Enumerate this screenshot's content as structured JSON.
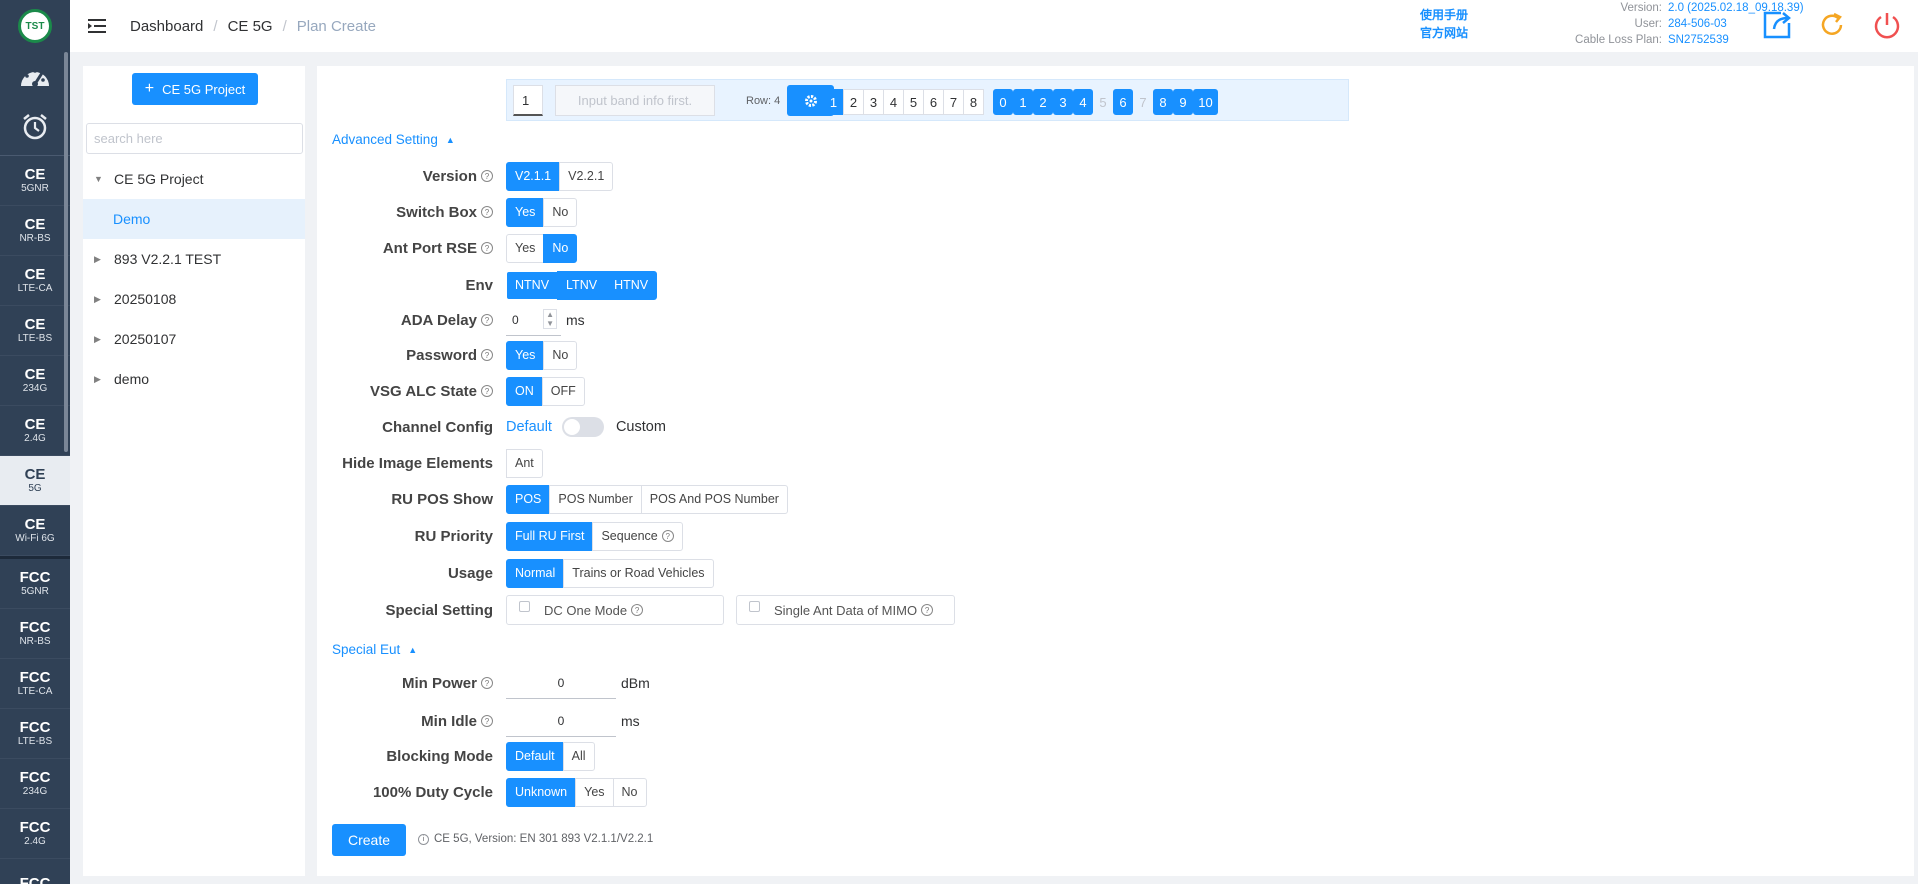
{
  "brand": {
    "logo_text": "TST"
  },
  "leftnav": {
    "items": [
      {
        "main": "CE",
        "sub": "5GNR"
      },
      {
        "main": "CE",
        "sub": "NR-BS"
      },
      {
        "main": "CE",
        "sub": "LTE-CA"
      },
      {
        "main": "CE",
        "sub": "LTE-BS"
      },
      {
        "main": "CE",
        "sub": "234G"
      },
      {
        "main": "CE",
        "sub": "2.4G"
      },
      {
        "main": "CE",
        "sub": "5G"
      },
      {
        "main": "CE",
        "sub": "Wi-Fi 6G"
      },
      {
        "main": "FCC",
        "sub": "5GNR"
      },
      {
        "main": "FCC",
        "sub": "NR-BS"
      },
      {
        "main": "FCC",
        "sub": "LTE-CA"
      },
      {
        "main": "FCC",
        "sub": "LTE-BS"
      },
      {
        "main": "FCC",
        "sub": "234G"
      },
      {
        "main": "FCC",
        "sub": "2.4G"
      },
      {
        "main": "FCC",
        "sub": ""
      }
    ],
    "active_index": 6
  },
  "header": {
    "breadcrumb": [
      "Dashboard",
      "CE 5G",
      "Plan Create"
    ],
    "links": [
      "使用手册",
      "官方网站"
    ],
    "version_label": "Version:",
    "version_value": "2.0 (2025.02.18_09.18.39)",
    "user_label": "User:",
    "user_value": "284-506-03",
    "cable_label": "Cable Loss Plan:",
    "cable_value": "SN2752539"
  },
  "tree": {
    "add_button": "CE 5G Project",
    "search_placeholder": "search here",
    "nodes": [
      {
        "label": "CE 5G Project",
        "expanded": true
      },
      {
        "label": "Demo",
        "selected": true
      },
      {
        "label": "893 V2.2.1 TEST"
      },
      {
        "label": "20250108"
      },
      {
        "label": "20250107"
      },
      {
        "label": "demo"
      }
    ]
  },
  "band": {
    "index_value": "1",
    "info_placeholder": "Input band info first.",
    "row_label": "Row: 4",
    "pages": [
      "1",
      "2",
      "3",
      "4",
      "5",
      "6",
      "7",
      "8"
    ],
    "ports": [
      "0",
      "1",
      "2",
      "3",
      "4",
      "5",
      "6",
      "7",
      "8",
      "9",
      "10"
    ]
  },
  "form": {
    "advanced_title": "Advanced Setting",
    "version": {
      "label": "Version",
      "options": [
        "V2.1.1",
        "V2.2.1"
      ]
    },
    "switch_box": {
      "label": "Switch Box",
      "options": [
        "Yes",
        "No"
      ]
    },
    "ant_port": {
      "label": "Ant Port RSE",
      "options": [
        "Yes",
        "No"
      ]
    },
    "env": {
      "label": "Env",
      "options": [
        "NTNV",
        "LTNV",
        "HTNV"
      ]
    },
    "ada_delay": {
      "label": "ADA Delay",
      "value": "0",
      "unit": "ms"
    },
    "password": {
      "label": "Password",
      "options": [
        "Yes",
        "No"
      ]
    },
    "vsg_alc": {
      "label": "VSG ALC State",
      "options": [
        "ON",
        "OFF"
      ]
    },
    "channel_config": {
      "label": "Channel Config",
      "left": "Default",
      "right": "Custom"
    },
    "hide_image": {
      "label": "Hide Image Elements",
      "options": [
        "Ant"
      ]
    },
    "ru_pos": {
      "label": "RU POS Show",
      "options": [
        "POS",
        "POS Number",
        "POS And POS Number"
      ]
    },
    "ru_priority": {
      "label": "RU Priority",
      "options": [
        "Full RU First",
        "Sequence"
      ]
    },
    "usage": {
      "label": "Usage",
      "options": [
        "Normal",
        "Trains or Road Vehicles"
      ]
    },
    "special_setting": {
      "label": "Special Setting",
      "options": [
        "DC One Mode",
        "Single Ant Data of MIMO"
      ]
    },
    "special_eut_title": "Special Eut",
    "min_power": {
      "label": "Min Power",
      "value": "0",
      "unit": "dBm"
    },
    "min_idle": {
      "label": "Min Idle",
      "value": "0",
      "unit": "ms"
    },
    "blocking": {
      "label": "Blocking Mode",
      "options": [
        "Default",
        "All"
      ]
    },
    "duty": {
      "label": "100% Duty Cycle",
      "options": [
        "Unknown",
        "Yes",
        "No"
      ]
    }
  },
  "footer": {
    "create_button": "Create",
    "note": "CE 5G, Version: EN 301 893 V2.1.1/V2.2.1"
  }
}
